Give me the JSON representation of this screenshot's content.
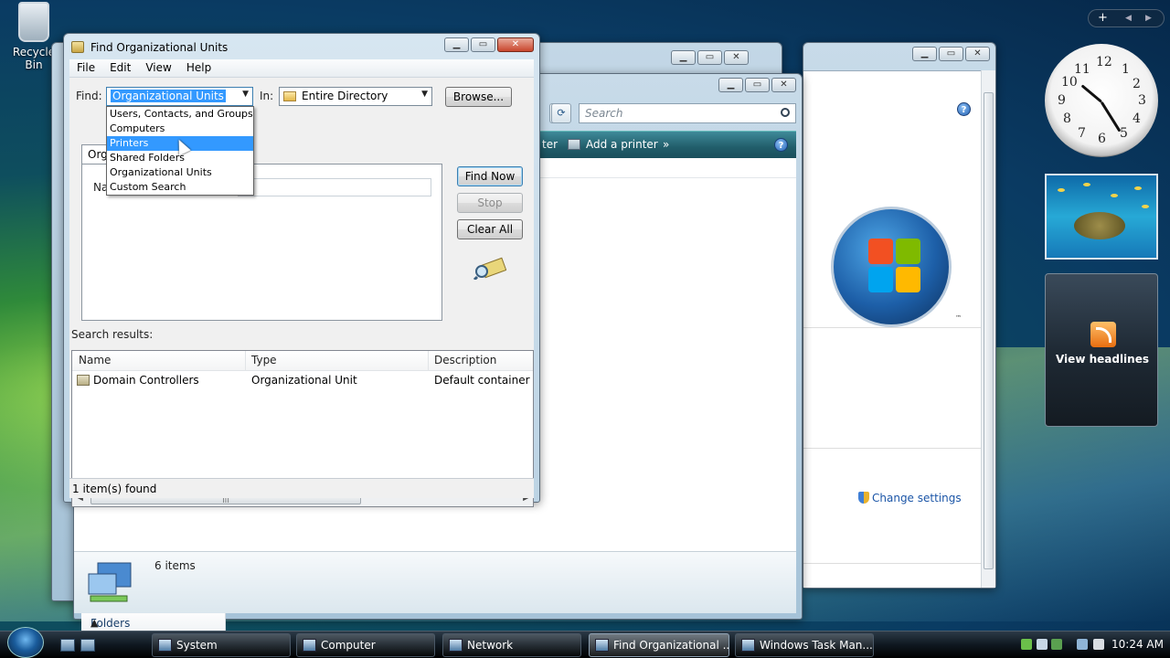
{
  "desktop": {
    "recycle_bin_label": "Recycle Bin"
  },
  "find_dialog": {
    "title": "Find Organizational Units",
    "menu": [
      "File",
      "Edit",
      "View",
      "Help"
    ],
    "find_label": "Find:",
    "find_value": "Organizational Units",
    "in_label": "In:",
    "in_value": "Entire Directory",
    "browse_label": "Browse...",
    "tab_label": "Orga",
    "name_label": "Na",
    "buttons": {
      "find_now": "Find Now",
      "stop": "Stop",
      "clear_all": "Clear All"
    },
    "dropdown_options": [
      "Users, Contacts, and Groups",
      "Computers",
      "Printers",
      "Shared Folders",
      "Organizational Units",
      "Custom Search"
    ],
    "dropdown_selected": "Printers",
    "results_label": "Search results:",
    "columns": [
      "Name",
      "Type",
      "Description"
    ],
    "rows": [
      {
        "name": "Domain Controllers",
        "type": "Organizational Unit",
        "description": "Default container for"
      }
    ],
    "status": "1 item(s) found"
  },
  "printers_window": {
    "search_placeholder": "Search",
    "cmd_partial": "ter",
    "add_printer": "Add a printer",
    "more": "»",
    "folders_label": "Folders",
    "item_count": "6 items"
  },
  "system_window": {
    "change_settings": "Change settings"
  },
  "gadgets": {
    "feed_label": "View headlines",
    "ctrl_plus": "+",
    "clock_numbers": [
      "12",
      "1",
      "2",
      "3",
      "4",
      "5",
      "6",
      "7",
      "8",
      "9",
      "10",
      "11"
    ]
  },
  "taskbar": {
    "buttons": [
      "System",
      "Computer",
      "Network",
      "Find Organizational ...",
      "Windows Task Man..."
    ],
    "active_index": 3,
    "time": "10:24 AM"
  },
  "colors": {
    "selection": "#3399ff",
    "link": "#1b55a7",
    "cmdbar": "#215d6a"
  }
}
